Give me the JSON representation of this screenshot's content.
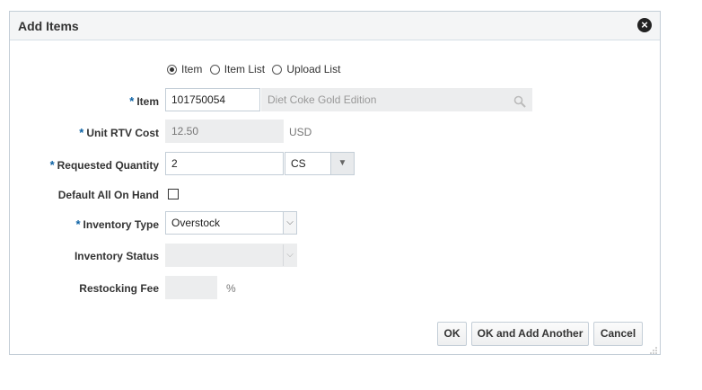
{
  "dialog": {
    "title": "Add Items",
    "close_icon": "close-icon"
  },
  "mode": {
    "options": [
      "Item",
      "Item List",
      "Upload List"
    ],
    "selected": "Item"
  },
  "fields": {
    "item": {
      "label": "Item",
      "required": "*",
      "value": "101750054",
      "description": "Diet Coke Gold Edition"
    },
    "unit_rtv_cost": {
      "label": "Unit RTV Cost",
      "required": "*",
      "value": "12.50",
      "currency": "USD"
    },
    "requested_quantity": {
      "label": "Requested Quantity",
      "required": "*",
      "value": "2",
      "uom": "CS"
    },
    "default_all_on_hand": {
      "label": "Default All On Hand",
      "checked": false
    },
    "inventory_type": {
      "label": "Inventory Type",
      "required": "*",
      "value": "Overstock"
    },
    "inventory_status": {
      "label": "Inventory Status",
      "value": ""
    },
    "restocking_fee": {
      "label": "Restocking Fee",
      "value": "",
      "unit": "%"
    }
  },
  "buttons": {
    "ok": "OK",
    "ok_add_another": "OK and Add Another",
    "cancel": "Cancel"
  }
}
